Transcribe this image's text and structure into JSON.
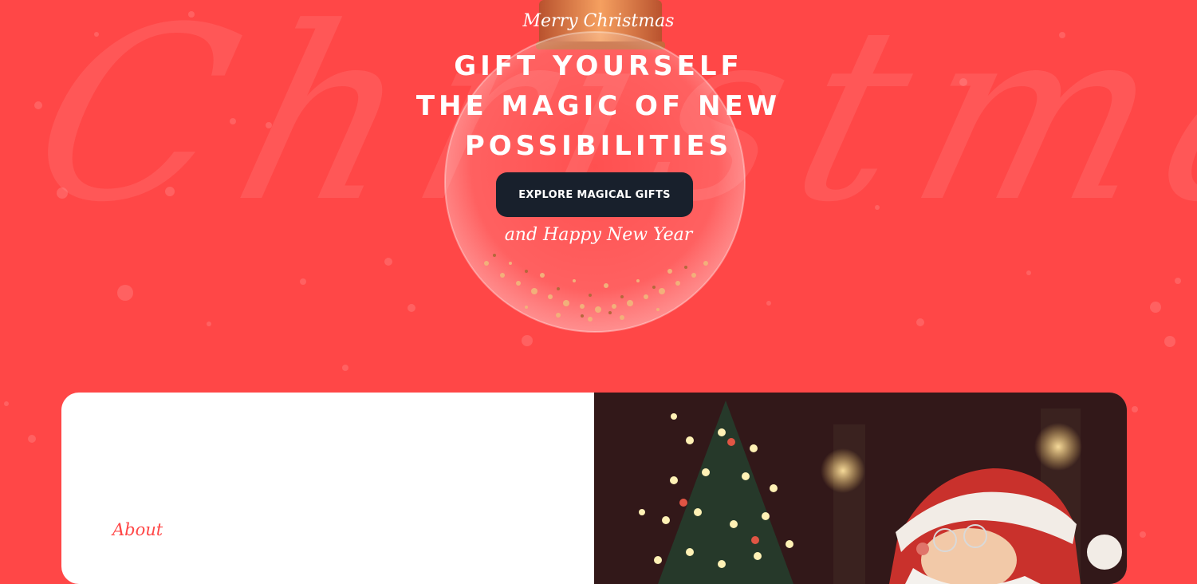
{
  "background_script": "Christmas",
  "hero": {
    "kicker": "Merry Christmas",
    "headline_lines": [
      "GIFT YOURSELF",
      "THE MAGIC OF NEW",
      "POSSIBILITIES"
    ],
    "cta_label": "EXPLORE MAGICAL GIFTS",
    "subline": "and Happy New Year"
  },
  "about": {
    "label": "About"
  },
  "colors": {
    "background": "#ff4747",
    "button": "#18202c",
    "text": "#ffffff",
    "accent": "#ff4747"
  }
}
